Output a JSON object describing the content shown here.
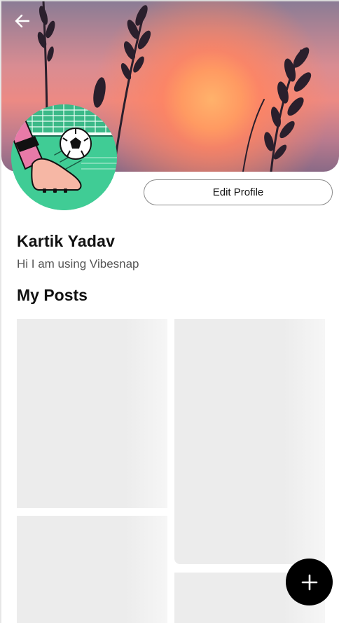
{
  "profile": {
    "name": "Kartik Yadav",
    "bio": "Hi I am using Vibesnap",
    "edit_label": "Edit Profile"
  },
  "posts_section": {
    "title": "My Posts",
    "posts": [
      {
        "state": "loading"
      },
      {
        "state": "loading"
      },
      {
        "state": "loading"
      },
      {
        "state": "loading"
      }
    ]
  },
  "icons": {
    "back": "arrow-left-icon",
    "add": "plus-icon"
  },
  "colors": {
    "fab_background": "#000000",
    "avatar_background": "#40cc95",
    "placeholder": "#ececec"
  }
}
